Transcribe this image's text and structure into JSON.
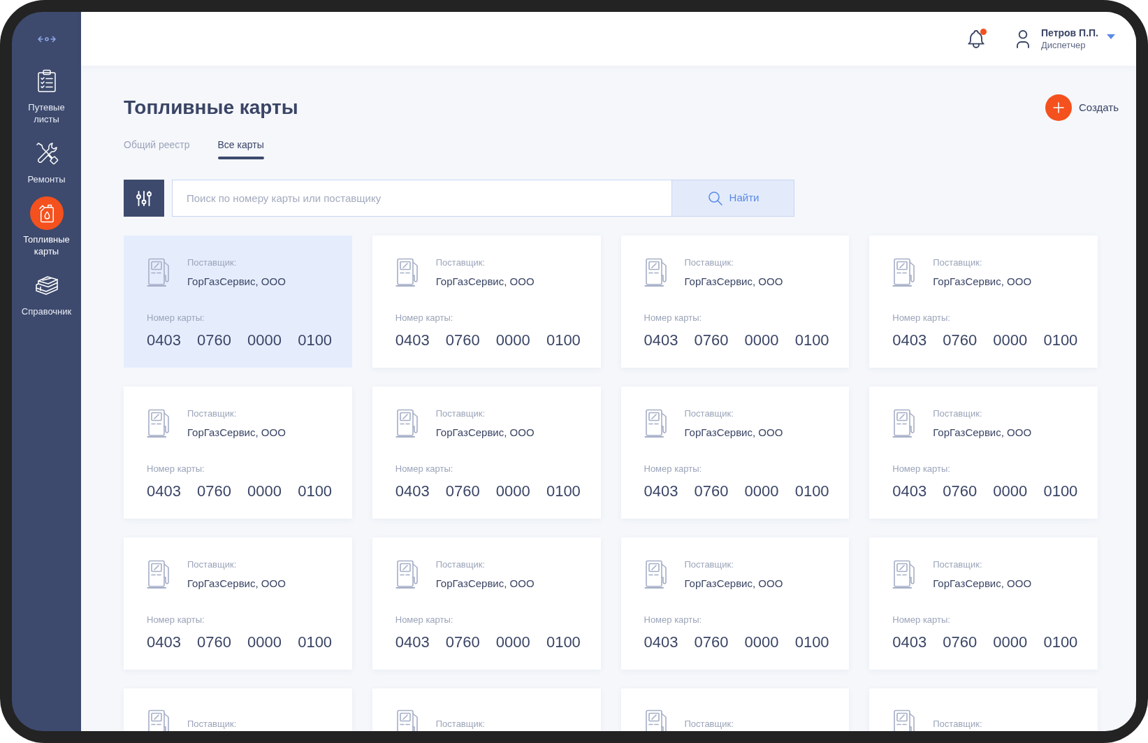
{
  "sidebar": {
    "items": [
      {
        "label": "Путевые листы",
        "selected": false
      },
      {
        "label": "Ремонты",
        "selected": false
      },
      {
        "label": "Топливные карты",
        "selected": true
      },
      {
        "label": "Справочник",
        "selected": false
      }
    ]
  },
  "header": {
    "notifications": {
      "unread": true
    },
    "user": {
      "name": "Петров П.П.",
      "role": "Диспетчер"
    }
  },
  "page": {
    "title": "Топливные карты",
    "create_button": "Создать"
  },
  "tabs": [
    {
      "label": "Общий реестр",
      "selected": false
    },
    {
      "label": "Все карты",
      "selected": true
    }
  ],
  "search": {
    "placeholder": "Поиск по номеру карты или поставщику",
    "button": "Найти"
  },
  "cards": [
    {
      "supplier_label": "Поставщик:",
      "supplier": "ГорГазСервис, ООО",
      "number_label": "Номер карты:",
      "number": "0403 0760 0000 0100",
      "selected": true
    },
    {
      "supplier_label": "Поставщик:",
      "supplier": "ГорГазСервис, ООО",
      "number_label": "Номер карты:",
      "number": "0403 0760 0000 0100",
      "selected": false
    },
    {
      "supplier_label": "Поставщик:",
      "supplier": "ГорГазСервис, ООО",
      "number_label": "Номер карты:",
      "number": "0403 0760 0000 0100",
      "selected": false
    },
    {
      "supplier_label": "Поставщик:",
      "supplier": "ГорГазСервис, ООО",
      "number_label": "Номер карты:",
      "number": "0403 0760 0000 0100",
      "selected": false
    },
    {
      "supplier_label": "Поставщик:",
      "supplier": "ГорГазСервис, ООО",
      "number_label": "Номер карты:",
      "number": "0403 0760 0000 0100",
      "selected": false
    },
    {
      "supplier_label": "Поставщик:",
      "supplier": "ГорГазСервис, ООО",
      "number_label": "Номер карты:",
      "number": "0403 0760 0000 0100",
      "selected": false
    },
    {
      "supplier_label": "Поставщик:",
      "supplier": "ГорГазСервис, ООО",
      "number_label": "Номер карты:",
      "number": "0403 0760 0000 0100",
      "selected": false
    },
    {
      "supplier_label": "Поставщик:",
      "supplier": "ГорГазСервис, ООО",
      "number_label": "Номер карты:",
      "number": "0403 0760 0000 0100",
      "selected": false
    },
    {
      "supplier_label": "Поставщик:",
      "supplier": "ГорГазСервис, ООО",
      "number_label": "Номер карты:",
      "number": "0403 0760 0000 0100",
      "selected": false
    },
    {
      "supplier_label": "Поставщик:",
      "supplier": "ГорГазСервис, ООО",
      "number_label": "Номер карты:",
      "number": "0403 0760 0000 0100",
      "selected": false
    },
    {
      "supplier_label": "Поставщик:",
      "supplier": "ГорГазСервис, ООО",
      "number_label": "Номер карты:",
      "number": "0403 0760 0000 0100",
      "selected": false
    },
    {
      "supplier_label": "Поставщик:",
      "supplier": "ГорГазСервис, ООО",
      "number_label": "Номер карты:",
      "number": "0403 0760 0000 0100",
      "selected": false
    },
    {
      "supplier_label": "Поставщик:",
      "selected": false
    },
    {
      "supplier_label": "Поставщик:",
      "selected": false
    },
    {
      "supplier_label": "Поставщик:",
      "selected": false
    },
    {
      "supplier_label": "Поставщик:",
      "selected": false
    }
  ]
}
